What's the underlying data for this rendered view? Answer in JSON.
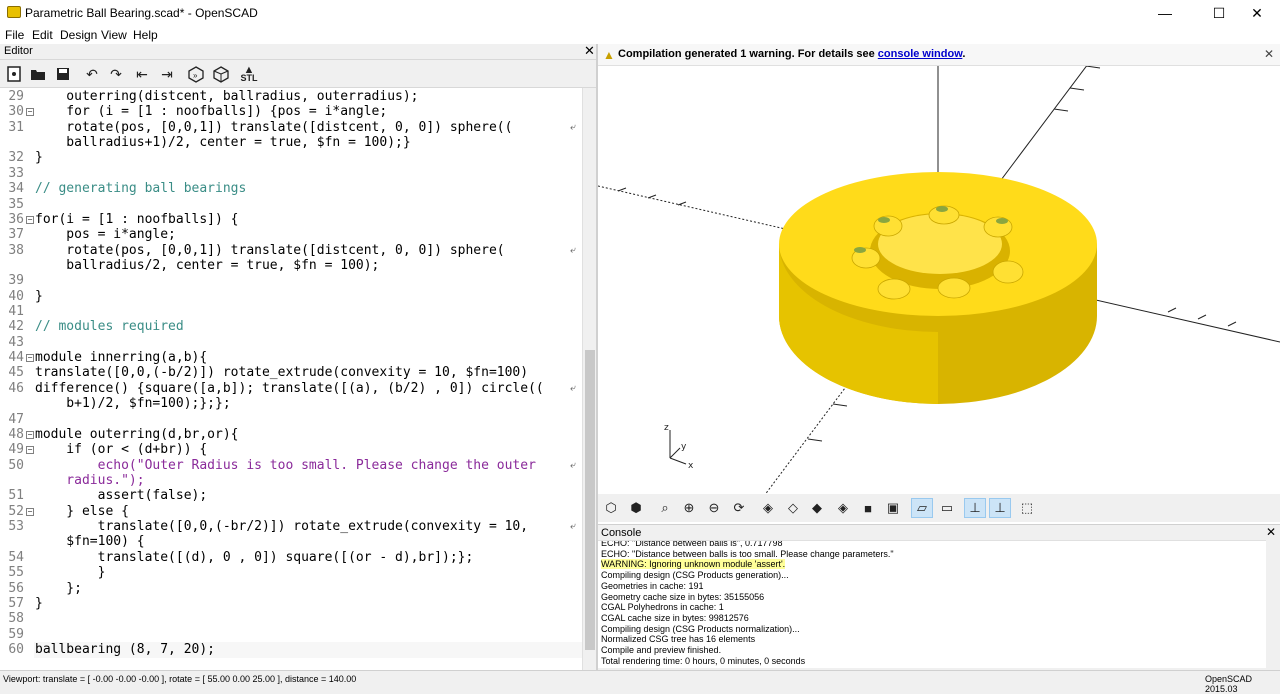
{
  "window": {
    "title": "Parametric Ball Bearing.scad* - OpenSCAD",
    "min": "—",
    "max": "☐",
    "close": "✕"
  },
  "menu": [
    "File",
    "Edit",
    "Design",
    "View",
    "Help"
  ],
  "editor": {
    "header": "Editor",
    "lines": [
      {
        "n": "29",
        "html": "    outerring(distcent, ballradius, outerradius);"
      },
      {
        "n": "30",
        "fold": true,
        "html": "    for (i = [1 : noofballs]) {pos = i*angle;"
      },
      {
        "n": "31",
        "wrap": true,
        "html": "    rotate(pos, [0,0,1]) translate([distcent, 0, 0]) sphere(("
      },
      {
        "n": "",
        "html": "    ballradius+1)/2, center = true, $fn = 100);}"
      },
      {
        "n": "32",
        "html": "}"
      },
      {
        "n": "33",
        "html": ""
      },
      {
        "n": "34",
        "html": "// generating ball bearings",
        "cls": "c-comment"
      },
      {
        "n": "35",
        "html": ""
      },
      {
        "n": "36",
        "fold": true,
        "html": "for(i = [1 : noofballs]) {"
      },
      {
        "n": "37",
        "html": "    pos = i*angle;"
      },
      {
        "n": "38",
        "wrap": true,
        "html": "    rotate(pos, [0,0,1]) translate([distcent, 0, 0]) sphere("
      },
      {
        "n": "",
        "html": "    ballradius/2, center = true, $fn = 100);"
      },
      {
        "n": "39",
        "html": ""
      },
      {
        "n": "40",
        "html": "}"
      },
      {
        "n": "41",
        "html": ""
      },
      {
        "n": "42",
        "html": "// modules required",
        "cls": "c-comment"
      },
      {
        "n": "43",
        "html": ""
      },
      {
        "n": "44",
        "fold": true,
        "html": "module innerring(a,b){"
      },
      {
        "n": "45",
        "html": "translate([0,0,(-b/2)]) rotate_extrude(convexity = 10, $fn=100)"
      },
      {
        "n": "46",
        "wrap": true,
        "html": "difference() {square([a,b]); translate([(a), (b/2) , 0]) circle(("
      },
      {
        "n": "",
        "html": "    b+1)/2, $fn=100);};};"
      },
      {
        "n": "47",
        "html": ""
      },
      {
        "n": "48",
        "fold": true,
        "html": "module outerring(d,br,or){"
      },
      {
        "n": "49",
        "fold": true,
        "html": "    if (or < (d+br)) {"
      },
      {
        "n": "50",
        "wrap": true,
        "html": "        echo(\"Outer Radius is too small. Please change the outer",
        "cls": "c-str"
      },
      {
        "n": "",
        "html": "    radius.\");",
        "cls": "c-str"
      },
      {
        "n": "51",
        "html": "        assert(false);"
      },
      {
        "n": "52",
        "fold": true,
        "html": "    } else {"
      },
      {
        "n": "53",
        "wrap": true,
        "html": "        translate([0,0,(-br/2)]) rotate_extrude(convexity = 10,"
      },
      {
        "n": "",
        "html": "    $fn=100) {"
      },
      {
        "n": "54",
        "html": "        translate([(d), 0 , 0]) square([(or - d),br]);};"
      },
      {
        "n": "55",
        "html": "        }"
      },
      {
        "n": "56",
        "html": "    };"
      },
      {
        "n": "57",
        "html": "}"
      },
      {
        "n": "58",
        "html": ""
      },
      {
        "n": "59",
        "html": ""
      },
      {
        "n": "60",
        "html": "ballbearing (8, 7, 20);",
        "cur": true
      }
    ]
  },
  "viewer": {
    "warning": "Compilation generated 1 warning. For details see",
    "warning_link": "console window",
    "warning_end": "."
  },
  "console": {
    "header": "Console",
    "lines": [
      {
        "t": "ECHO: \"Distance between balls is\", 0.717798"
      },
      {
        "t": "ECHO: \"Distance between balls is too small. Please change parameters.\""
      },
      {
        "t": "WARNING: Ignoring unknown module 'assert'.",
        "warn": true
      },
      {
        "t": "Compiling design (CSG Products generation)..."
      },
      {
        "t": "Geometries in cache: 191"
      },
      {
        "t": "Geometry cache size in bytes: 35155056"
      },
      {
        "t": "CGAL Polyhedrons in cache: 1"
      },
      {
        "t": "CGAL cache size in bytes: 99812576"
      },
      {
        "t": "Compiling design (CSG Products normalization)..."
      },
      {
        "t": "Normalized CSG tree has 16 elements"
      },
      {
        "t": "Compile and preview finished."
      },
      {
        "t": "Total rendering time: 0 hours, 0 minutes, 0 seconds"
      }
    ]
  },
  "status": {
    "viewport": "Viewport: translate = [ -0.00 -0.00 -0.00 ], rotate = [ 55.00 0.00 25.00 ], distance = 140.00",
    "version": "OpenSCAD 2015.03"
  },
  "axis_labels": {
    "x": "x",
    "y": "y",
    "z": "z"
  },
  "stl_label": "STL"
}
